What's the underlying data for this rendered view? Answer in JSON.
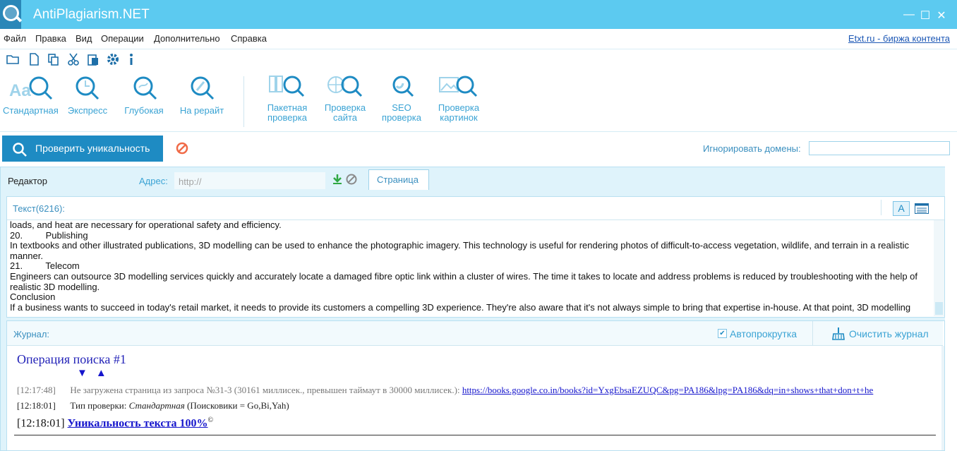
{
  "window": {
    "title": "AntiPlagiarism.NET",
    "minimize": "—",
    "maximize": "☐",
    "close": "✕"
  },
  "menu": {
    "items": [
      "Файл",
      "Правка",
      "Вид",
      "Операции",
      "Дополнительно",
      "Справка"
    ],
    "right_link": "Etxt.ru - биржа контента"
  },
  "quick_toolbar": {
    "icons": [
      "open-folder-icon",
      "new-file-icon",
      "copy-icon",
      "cut-icon",
      "paste-icon",
      "settings-icon",
      "info-icon"
    ]
  },
  "ribbon": {
    "buttons": [
      {
        "label": "Стандартная"
      },
      {
        "label": "Экспресс"
      },
      {
        "label": "Глубокая"
      },
      {
        "label": "На рерайт"
      },
      {
        "label_line1": "Пакетная",
        "label_line2": "проверка"
      },
      {
        "label_line1": "Проверка",
        "label_line2": "сайта"
      },
      {
        "label_line1": "SEO",
        "label_line2": "проверка"
      },
      {
        "label_line1": "Проверка",
        "label_line2": "картинок"
      }
    ]
  },
  "actions": {
    "check_button": "Проверить уникальность",
    "ignore_domains_label": "Игнорировать домены:",
    "ignore_domains_value": ""
  },
  "editor": {
    "tab_editor": "Редактор",
    "address_label": "Адрес:",
    "address_placeholder": "http://",
    "tab_page": "Страница",
    "text_count_label": "Текст(6216):",
    "text_lines": [
      "loads, and heat are necessary for operational safety and efficiency.",
      "20.         Publishing",
      "In textbooks and other illustrated publications, 3D modelling can be used to enhance the photographic imagery. This technology is useful for rendering photos of difficult-to-access vegetation, wildlife, and terrain in a realistic manner.",
      "21.         Telecom",
      "Engineers can outsource 3D modelling services quickly and accurately locate a damaged fibre optic link within a cluster of wires. The time it takes to locate and address problems is reduced by troubleshooting with the help of realistic 3D modelling.",
      "Conclusion",
      "If a business wants to succeed in today's retail market, it needs to provide its customers a compelling 3D experience. They're also aware that it's not always simple to bring that expertise in-house. At that point, 3D modelling"
    ]
  },
  "journal": {
    "label": "Журнал:",
    "autoscroll_label": "Автопрокрутка",
    "autoscroll_checked": true,
    "clear_label": "Очистить журнал",
    "operation_title": "Операция поиска #1",
    "arrow_down": "▼",
    "arrow_up": "▲",
    "entries": [
      {
        "time": "[12:17:48]",
        "text": "Не загружена страница из запроса №31-3 (30161 миллисек., превышен таймаут в 30000 миллисек.):",
        "link": "https://books.google.co.in/books?id=YxgEbsaEZUQC&pg=PA186&lpg=PA186&dq=in+shows+that+don+t+he"
      },
      {
        "time": "[12:18:01]",
        "text_prefix": "Тип проверки:",
        "text_italic": "Стандартная",
        "text_suffix": "(Поисковики = Go,Bi,Yah)"
      }
    ],
    "result_time": "[12:18:01]",
    "result_text": "Уникальность текста 100%",
    "result_mark": "©"
  }
}
